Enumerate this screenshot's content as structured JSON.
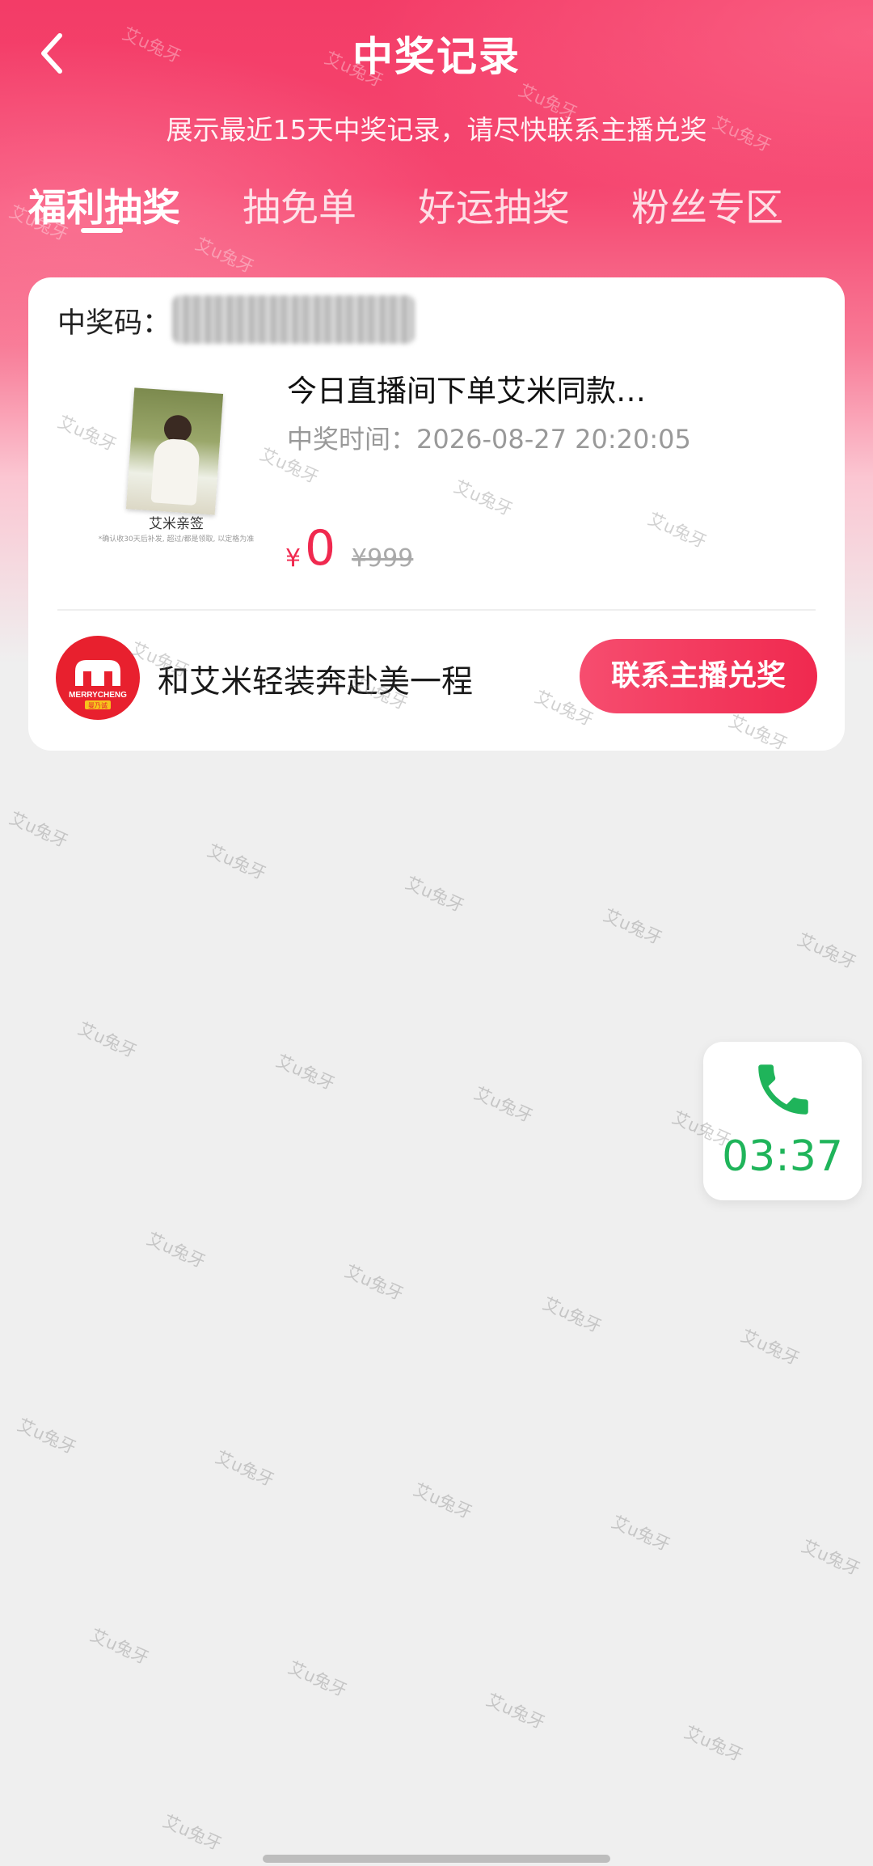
{
  "header": {
    "title": "中奖记录",
    "subtitle": "展示最近15天中奖记录，请尽快联系主播兑奖",
    "back_icon": "chevron-left-icon"
  },
  "tabs": [
    {
      "label": "福利抽奖",
      "active": true
    },
    {
      "label": "抽免单",
      "active": false
    },
    {
      "label": "好运抽奖",
      "active": false
    },
    {
      "label": "粉丝专区",
      "active": false
    }
  ],
  "record": {
    "code_label": "中奖码：",
    "product_image_caption": "艾米亲签",
    "product_image_fineprint": "*确认收30天后补发, 超过/都是领取, 以定格为准",
    "product_title": "今日直播间下单艾米同款…",
    "win_time": "中奖时间：2026-08-27 20:20:05",
    "price_symbol": "¥",
    "price": "0",
    "original_price": "¥999",
    "store_name": "和艾米轻装奔赴美一程",
    "store_logo_text": "MERRYCHENG",
    "store_logo_sub": "曼乃诚",
    "contact_button": "联系主播兑奖"
  },
  "call_widget": {
    "icon": "phone-icon",
    "duration": "03:37",
    "color": "#1fb45a"
  },
  "watermark": "艾u兔牙",
  "colors": {
    "accent": "#f0294f",
    "header_gradient_top": "#f33c67",
    "background": "#efefef"
  }
}
